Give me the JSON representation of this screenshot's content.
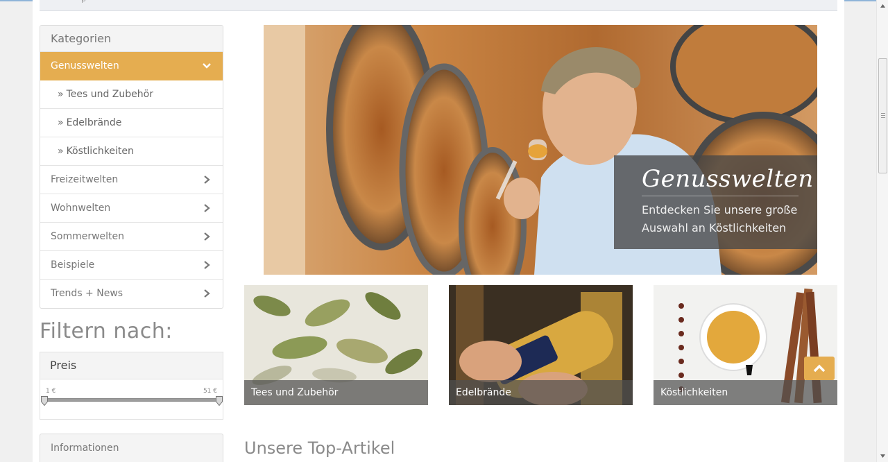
{
  "colors": {
    "accent": "#e5ad50",
    "text_muted": "#777777",
    "overlay": "#464646"
  },
  "sidebar": {
    "categories_title": "Kategorien",
    "items": [
      {
        "label": "Genusswelten",
        "active": true,
        "icon": "chevron-down-icon"
      },
      {
        "label": "Tees und Zubehör",
        "sub": true,
        "prefix": "»"
      },
      {
        "label": "Edelbrände",
        "sub": true,
        "prefix": "»"
      },
      {
        "label": "Köstlichkeiten",
        "sub": true,
        "prefix": "»"
      },
      {
        "label": "Freizeitwelten",
        "icon": "chevron-right-icon"
      },
      {
        "label": "Wohnwelten",
        "icon": "chevron-right-icon"
      },
      {
        "label": "Sommerwelten",
        "icon": "chevron-right-icon"
      },
      {
        "label": "Beispiele",
        "icon": "chevron-right-icon"
      },
      {
        "label": "Trends + News",
        "icon": "chevron-right-icon"
      }
    ],
    "filter_title": "Filtern nach:",
    "price": {
      "label": "Preis",
      "min_label": "1 €",
      "max_label": "51 €"
    },
    "info_title": "Informationen"
  },
  "hero": {
    "title": "Genusswelten",
    "subtitle": "Entdecken Sie unsere große Auswahl an Köstlichkeiten"
  },
  "tiles": [
    {
      "label": "Tees und Zubehör"
    },
    {
      "label": "Edelbrände"
    },
    {
      "label": "Köstlichkeiten"
    }
  ],
  "section_title": "Unsere Top-Artikel"
}
